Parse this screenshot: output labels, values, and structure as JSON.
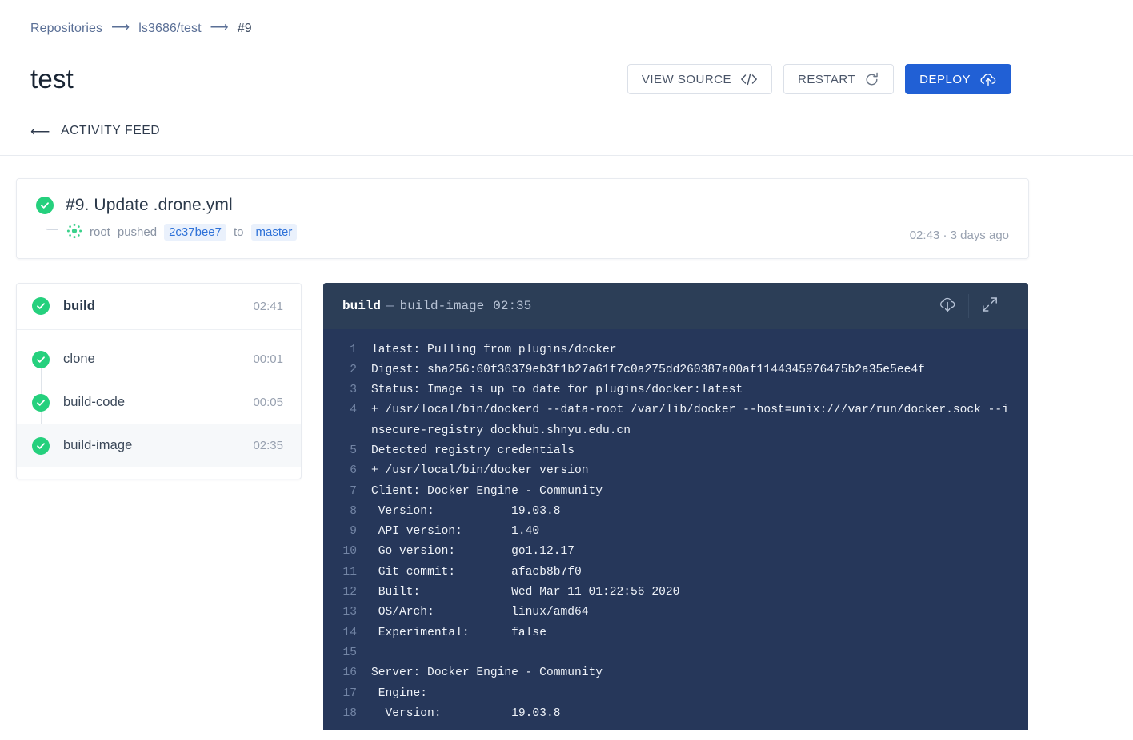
{
  "breadcrumb": {
    "items": [
      {
        "label": "Repositories",
        "type": "link"
      },
      {
        "label": "ls3686/test",
        "type": "link"
      },
      {
        "label": "#9",
        "type": "current"
      }
    ],
    "separator": "⟶"
  },
  "header": {
    "title": "test",
    "actions": {
      "view_source": "VIEW SOURCE",
      "restart": "RESTART",
      "deploy": "DEPLOY"
    },
    "back_link": "ACTIVITY FEED",
    "back_arrow": "⟵"
  },
  "build": {
    "title": "#9. Update .drone.yml",
    "status": "success",
    "author": "root",
    "action_text": "pushed",
    "commit": "2c37bee7",
    "preposition": "to",
    "branch": "master",
    "time": "02:43",
    "relative_time": "3 days ago",
    "time_separator": "·"
  },
  "steps": {
    "header": {
      "label": "build",
      "time": "02:41",
      "status": "success"
    },
    "items": [
      {
        "label": "clone",
        "time": "00:01",
        "status": "success",
        "selected": false
      },
      {
        "label": "build-code",
        "time": "00:05",
        "status": "success",
        "selected": false
      },
      {
        "label": "build-image",
        "time": "02:35",
        "status": "success",
        "selected": true
      }
    ]
  },
  "log": {
    "stage": "build",
    "separator": "—",
    "step": "build-image",
    "time": "02:35",
    "tools": {
      "download": "cloud-download-icon",
      "expand": "expand-icon"
    },
    "lines": [
      {
        "n": "1",
        "text": "latest: Pulling from plugins/docker"
      },
      {
        "n": "2",
        "text": "Digest: sha256:60f36379eb3f1b27a61f7c0a275dd260387a00af1144345976475b2a35e5ee4f"
      },
      {
        "n": "3",
        "text": "Status: Image is up to date for plugins/docker:latest"
      },
      {
        "n": "4",
        "text": "+ /usr/local/bin/dockerd --data-root /var/lib/docker --host=unix:///var/run/docker.sock --insecure-registry dockhub.shnyu.edu.cn"
      },
      {
        "n": "5",
        "text": "Detected registry credentials"
      },
      {
        "n": "6",
        "text": "+ /usr/local/bin/docker version"
      },
      {
        "n": "7",
        "text": "Client: Docker Engine - Community"
      },
      {
        "n": "8",
        "text": " Version:           19.03.8"
      },
      {
        "n": "9",
        "text": " API version:       1.40"
      },
      {
        "n": "10",
        "text": " Go version:        go1.12.17"
      },
      {
        "n": "11",
        "text": " Git commit:        afacb8b7f0"
      },
      {
        "n": "12",
        "text": " Built:             Wed Mar 11 01:22:56 2020"
      },
      {
        "n": "13",
        "text": " OS/Arch:           linux/amd64"
      },
      {
        "n": "14",
        "text": " Experimental:      false"
      },
      {
        "n": "15",
        "text": ""
      },
      {
        "n": "16",
        "text": "Server: Docker Engine - Community"
      },
      {
        "n": "17",
        "text": " Engine:"
      },
      {
        "n": "18",
        "text": "  Version:          19.03.8"
      }
    ]
  },
  "colors": {
    "accent_blue": "#2160d5",
    "link_blue": "#2f72d8",
    "success_green": "#25d07d",
    "log_bg": "#26375a",
    "log_head_bg": "#2c3e57"
  }
}
